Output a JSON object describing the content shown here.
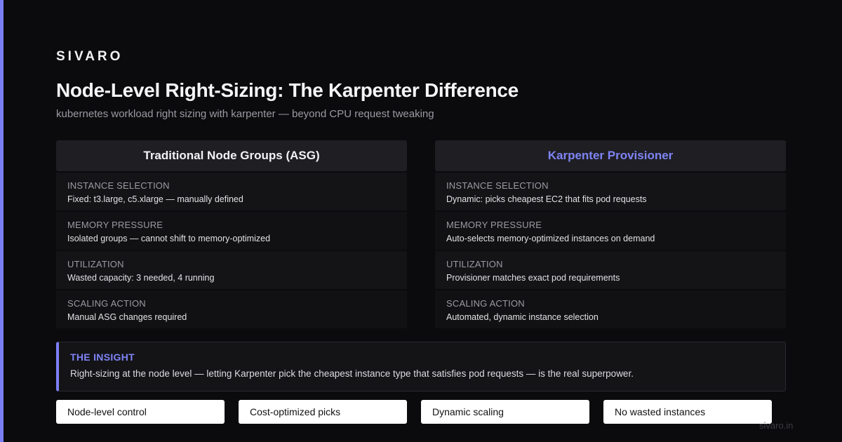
{
  "brand": "SIVARO",
  "title": "Node-Level Right-Sizing: The Karpenter Difference",
  "subtitle": "kubernetes workload right sizing with karpenter — beyond CPU request tweaking",
  "colors": {
    "accent": "#7b7ff5",
    "background": "#0b0b0d"
  },
  "left": {
    "header": "Traditional Node Groups (ASG)",
    "rows": [
      {
        "label": "INSTANCE SELECTION",
        "value": "Fixed: t3.large, c5.xlarge — manually defined"
      },
      {
        "label": "MEMORY PRESSURE",
        "value": "Isolated groups — cannot shift to memory-optimized"
      },
      {
        "label": "UTILIZATION",
        "value": "Wasted capacity: 3 needed, 4 running"
      },
      {
        "label": "SCALING ACTION",
        "value": "Manual ASG changes required"
      }
    ]
  },
  "right": {
    "header": "Karpenter Provisioner",
    "rows": [
      {
        "label": "INSTANCE SELECTION",
        "value": "Dynamic: picks cheapest EC2 that fits pod requests"
      },
      {
        "label": "MEMORY PRESSURE",
        "value": "Auto-selects memory-optimized instances on demand"
      },
      {
        "label": "UTILIZATION",
        "value": "Provisioner matches exact pod requirements"
      },
      {
        "label": "SCALING ACTION",
        "value": "Automated, dynamic instance selection"
      }
    ]
  },
  "insight": {
    "title": "THE INSIGHT",
    "text": "Right-sizing at the node level — letting Karpenter pick the cheapest instance type that satisfies pod requests — is the real superpower."
  },
  "chips": [
    "Node-level control",
    "Cost-optimized picks",
    "Dynamic scaling",
    "No wasted instances"
  ],
  "domain": "sivaro.in"
}
